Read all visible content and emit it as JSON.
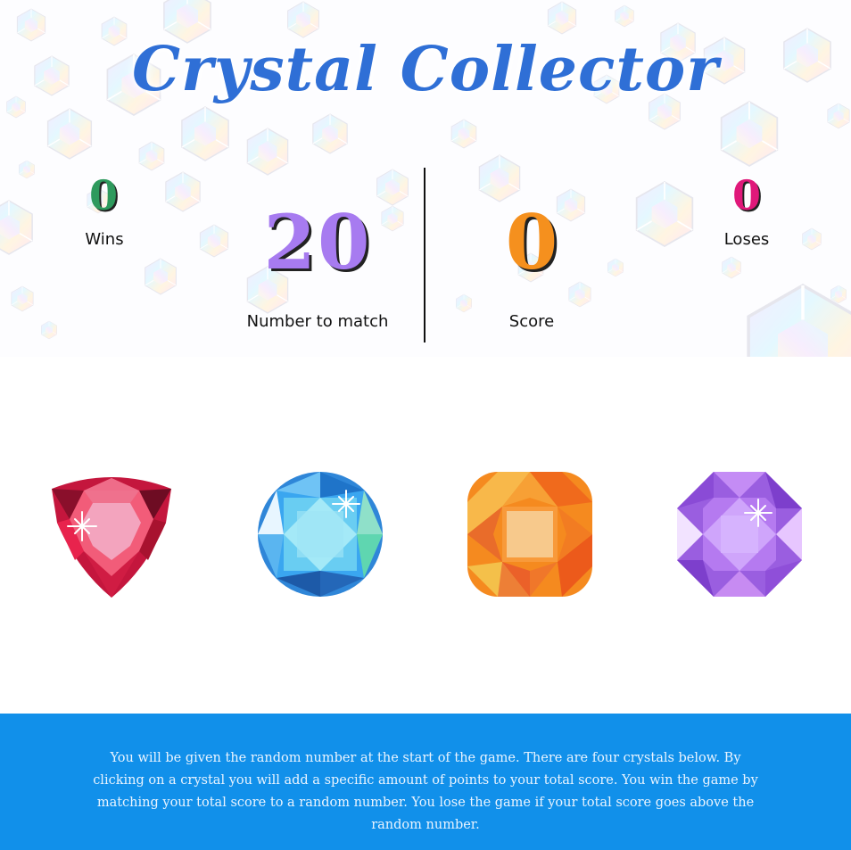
{
  "title": "Crystal Collector",
  "stats": {
    "wins": {
      "label": "Wins",
      "value": "0"
    },
    "target": {
      "label": "Number to match",
      "value": "20"
    },
    "score": {
      "label": "Score",
      "value": "0"
    },
    "loses": {
      "label": "Loses",
      "value": "0"
    }
  },
  "crystals": [
    {
      "name": "red-trillion-crystal",
      "color": "#e8234d"
    },
    {
      "name": "blue-round-crystal",
      "color": "#3aa6f0"
    },
    {
      "name": "orange-cushion-crystal",
      "color": "#f5881f"
    },
    {
      "name": "purple-octagon-crystal",
      "color": "#b26ef0"
    }
  ],
  "instructions": "You will be given the random number at the start of the game. There are four crystals below. By clicking on a crystal you will add a specific amount of points to your total score. You win the game by matching your total score to a random number. You lose the game if your total score goes above the random number.",
  "colors": {
    "title": "#2f6fd6",
    "wins": "#2e9a5d",
    "loses": "#e0187a",
    "target": "#a77bf0",
    "score": "#f5901e",
    "instructions_bg": "#1190ea"
  }
}
